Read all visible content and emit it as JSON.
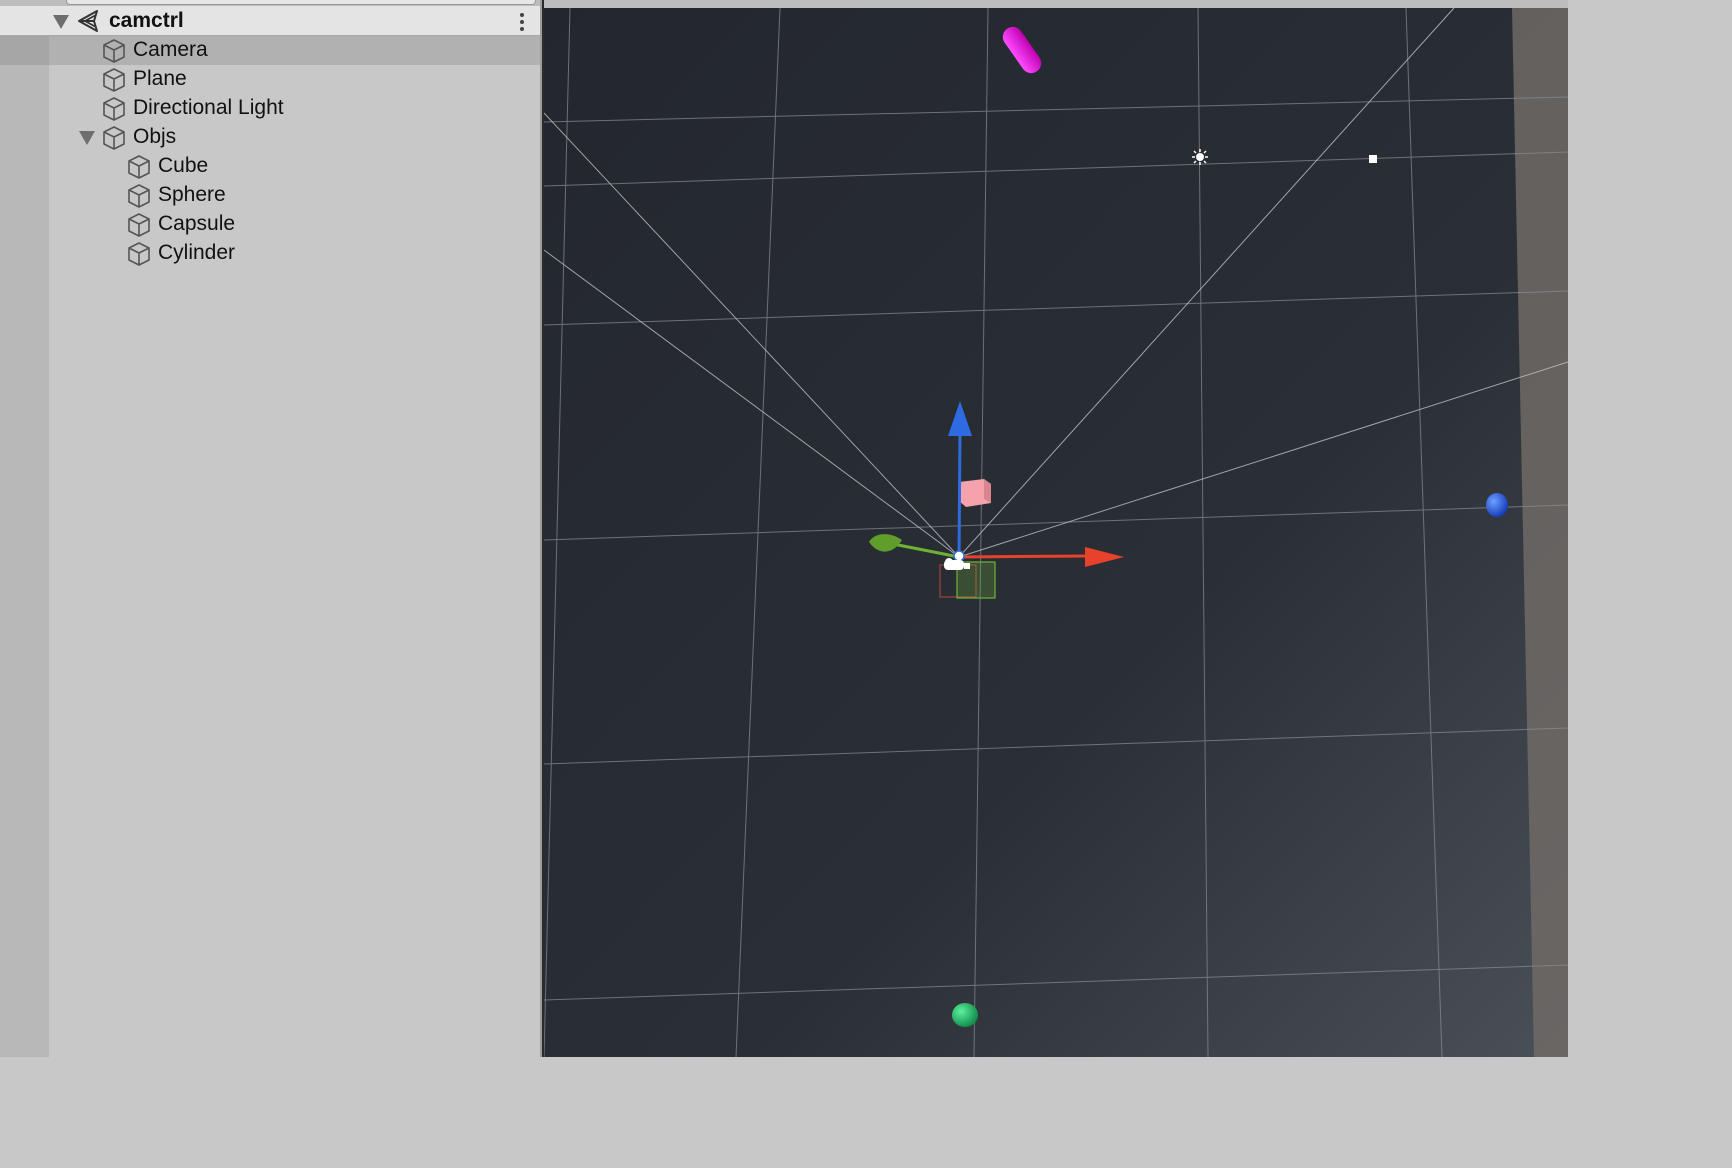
{
  "hierarchy": {
    "scene": {
      "name": "camctrl",
      "icon": "unity-scene-icon"
    },
    "items": [
      {
        "label": "Camera",
        "icon": "gameobject-cube-icon",
        "selected": true
      },
      {
        "label": "Plane",
        "icon": "gameobject-cube-icon"
      },
      {
        "label": "Directional Light",
        "icon": "gameobject-cube-icon"
      },
      {
        "label": "Objs",
        "icon": "gameobject-cube-icon",
        "expanded": true,
        "children": [
          {
            "label": "Cube",
            "icon": "gameobject-cube-icon"
          },
          {
            "label": "Sphere",
            "icon": "gameobject-cube-icon"
          },
          {
            "label": "Capsule",
            "icon": "gameobject-cube-icon"
          },
          {
            "label": "Cylinder",
            "icon": "gameobject-cube-icon"
          }
        ]
      }
    ],
    "menu_icon": "kebab-menu-icon"
  },
  "scene_view": {
    "background_color": "#262a31",
    "grid_color": "#8a8f96",
    "gizmo_colors": {
      "x": "#e8412c",
      "y": "#6fb233",
      "z": "#2f6be0"
    },
    "objects": [
      {
        "name": "capsule",
        "color": "#e800d8"
      },
      {
        "name": "cube",
        "color": "#f4a3ad"
      },
      {
        "name": "sphere-blue",
        "color": "#1f52e8"
      },
      {
        "name": "sphere-green",
        "color": "#1bbb6a"
      },
      {
        "name": "light-icon",
        "color": "#ffffff"
      }
    ]
  }
}
